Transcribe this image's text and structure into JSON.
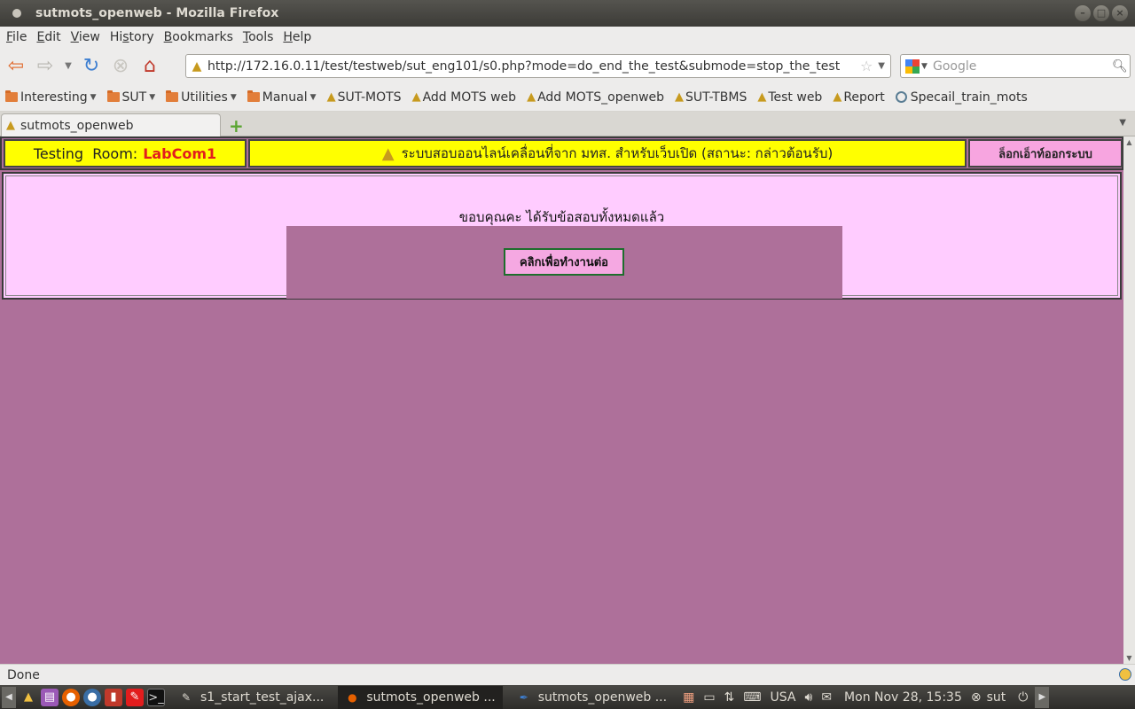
{
  "window": {
    "title": "sutmots_openweb - Mozilla Firefox"
  },
  "menu": [
    "File",
    "Edit",
    "View",
    "History",
    "Bookmarks",
    "Tools",
    "Help"
  ],
  "menu_mnemonics": [
    "F",
    "E",
    "V",
    "s",
    "B",
    "T",
    "H"
  ],
  "url": "http://172.16.0.11/test/testweb/sut_eng101/s0.php?mode=do_end_the_test&submode=stop_the_test",
  "search": {
    "placeholder": "Google"
  },
  "bookmarks": {
    "folders": [
      "Interesting",
      "SUT",
      "Utilities",
      "Manual"
    ],
    "links": [
      "SUT-MOTS",
      "Add MOTS web",
      "Add MOTS_openweb",
      "SUT-TBMS",
      "Test web",
      "Report"
    ],
    "last": "Specail_train_mots"
  },
  "tab": {
    "label": "sutmots_openweb"
  },
  "page": {
    "room_label": "Testing  Room:",
    "room_value": "LabCom1",
    "system_title": "ระบบสอบออนไลน์เคลื่อนที่จาก มทส. สำหรับเว็บเปิด (สถานะ: กล่าวต้อนรับ)",
    "logout_label": "ล็อกเอ็าท์ออกระบบ",
    "thanks_message": "ขอบคุณคะ ได้รับข้อสอบทั้งหมดแล้ว",
    "continue_label": "คลิกเพื่อทำงานต่อ"
  },
  "status": {
    "text": "Done"
  },
  "taskbar": {
    "tasks": [
      "s1_start_test_ajax...",
      "sutmots_openweb ...",
      "sutmots_openweb ..."
    ],
    "keyboard": "USA",
    "clock": "Mon Nov 28, 15:35",
    "user": "sut"
  },
  "colors": {
    "page_background": "#ae709a",
    "header_yellow": "#ffff00",
    "panel_pink": "#ffccff",
    "room_red": "#e21d1d",
    "logout_pink": "#f7a5e0",
    "button_border_green": "#1d6e2c"
  }
}
